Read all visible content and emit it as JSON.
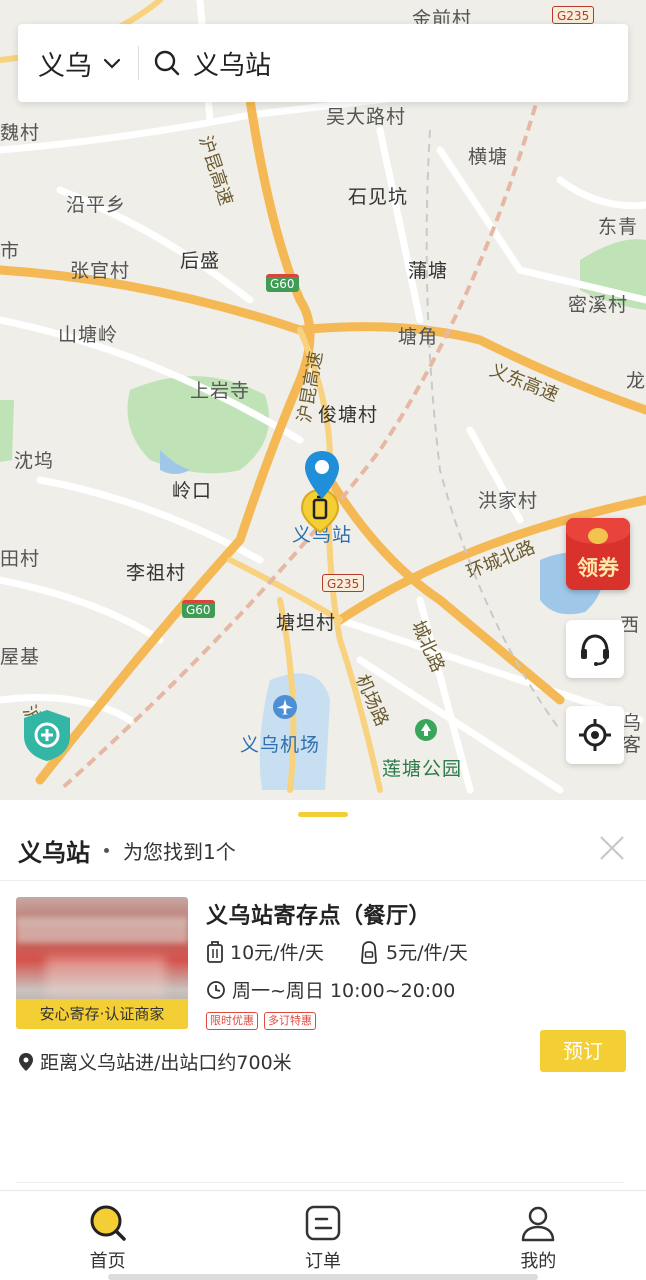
{
  "search": {
    "city": "义乌",
    "query": "义乌站"
  },
  "map": {
    "labels": {
      "jinqian_village": "金前村",
      "wei_village": "魏村",
      "wuda_village": "吴大路村",
      "hengtang": "横塘",
      "yanping": "沿平乡",
      "shijiankeng": "石见坑",
      "dongqing": "东青",
      "zhangguan": "张官村",
      "housheng": "后盛",
      "putang": "蒲塘",
      "mixi": "密溪村",
      "shantangling": "山塘岭",
      "tangjiao": "塘角",
      "long": "龙",
      "shangyansi": "上岩寺",
      "juntang": "俊塘村",
      "shenwu": "沈坞",
      "lingkou": "岭口",
      "hongjia": "洪家村",
      "station_map": "义乌站",
      "lizu": "李祖村",
      "tangtan": "塘坦村",
      "wubi": "屋基",
      "airport": "义乌机场",
      "liantang_park": "莲塘公园",
      "wu_right": "乌",
      "ke_right": "客",
      "xi_right": "西",
      "tian_left": "田村",
      "hu_left": "市"
    },
    "road_labels": {
      "hukun_north": "沪昆高速",
      "hukun_mid": "沪昆高速",
      "yidong": "义东高速",
      "huancheng": "环城北路",
      "chengbei": "城北路",
      "jichang": "机场路",
      "hu_sw": "沪"
    },
    "shields": {
      "g235_top": "G235",
      "g60_a": "G60",
      "g235_mid": "G235",
      "g60_b": "G60"
    },
    "coupon_label": "领券"
  },
  "sheet": {
    "title": "义乌站",
    "subtitle": "为您找到1个",
    "result": {
      "name": "义乌站寄存点（餐厅）",
      "badge": "安心寄存·认证商家",
      "price_large": "10元/件/天",
      "price_small": "5元/件/天",
      "hours": "周一~周日 10:00~20:00",
      "tags": [
        "限时优惠",
        "多订特惠"
      ],
      "distance": "距离义乌站进/出站口约700米",
      "book_label": "预订"
    }
  },
  "tabs": [
    {
      "label": "首页",
      "icon": "home-search-icon"
    },
    {
      "label": "订单",
      "icon": "orders-icon"
    },
    {
      "label": "我的",
      "icon": "profile-icon"
    }
  ],
  "colors": {
    "accent": "#f3cf35",
    "pin": "#1e8fd8",
    "coupon": "#d9312b",
    "tag": "#e04a3f"
  }
}
